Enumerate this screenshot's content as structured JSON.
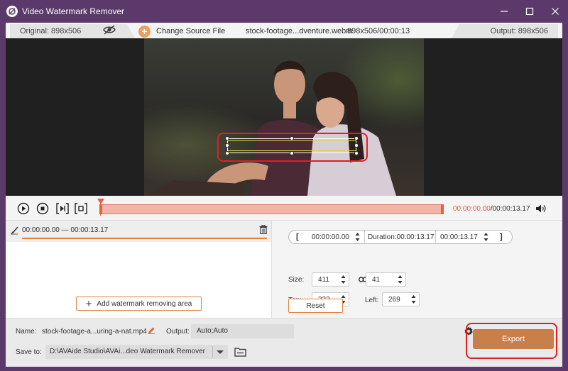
{
  "window": {
    "title": "Video Watermark Remover",
    "icon": "watermark-logo-icon",
    "controls": [
      "minimize-icon",
      "maximize-icon",
      "close-icon"
    ]
  },
  "infobar": {
    "original_label": "Original: 898x506",
    "change_source_label": "Change Source File",
    "file_name": "stock-footage...dventure.webm",
    "file_meta": "898x506/00:00:13",
    "output_label": "Output: 898x506"
  },
  "timeline": {
    "current_time": "00:00:00.00",
    "separator": "/",
    "total_time": "00:00:13.17",
    "playhead_progress": 0
  },
  "area_list": {
    "items": [
      {
        "range": "00:00:00.00 — 00:00:13.17"
      }
    ],
    "add_button_label": "Add watermark removing area"
  },
  "settings": {
    "start_time": "00:00:00.00",
    "duration_label": "Duration:00:00:13.17",
    "end_time": "00:00:13.17",
    "size_label": "Size:",
    "width": "411",
    "height": "41",
    "top_label": "Top:",
    "top": "323",
    "left_label": "Left:",
    "left": "269",
    "reset_label": "Reset"
  },
  "bottom": {
    "name_label": "Name:",
    "name_value": "stock-footage-a...uring-a-nat.mp4",
    "output_label": "Output:",
    "output_value": "Auto;Auto",
    "save_label": "Save to:",
    "save_path": "D:\\AVAide Studio\\AVAi...deo Watermark Remover",
    "export_label": "Export"
  },
  "colors": {
    "title_bar": "#5b3a6b",
    "accent": "#e8803c",
    "export": "#c97f4c",
    "highlight": "#e02020"
  }
}
